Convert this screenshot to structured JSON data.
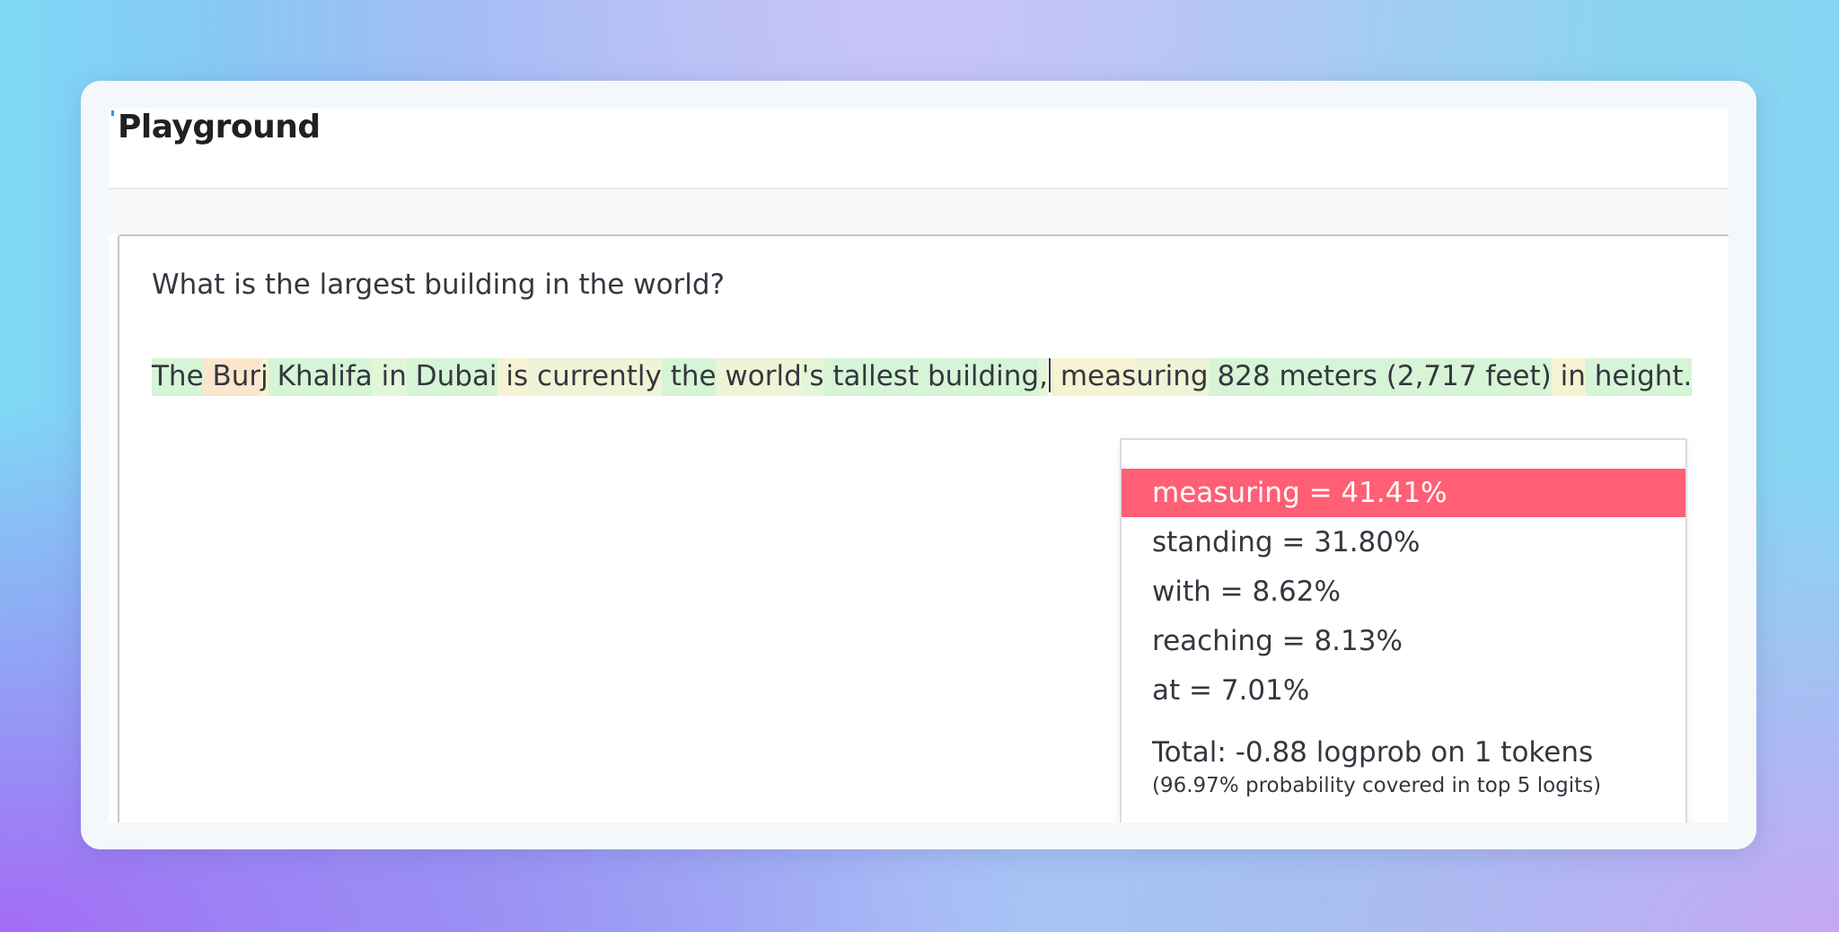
{
  "header": {
    "title": "Playground"
  },
  "editor": {
    "prompt": "What is the largest building in the world?",
    "completion_tokens": [
      {
        "text": "The",
        "tone": "t-green"
      },
      {
        "text": " Bur",
        "tone": "t-orange"
      },
      {
        "text": "j",
        "tone": "t-yellow"
      },
      {
        "text": " Khalifa",
        "tone": "t-green"
      },
      {
        "text": " in",
        "tone": "t-lgreen"
      },
      {
        "text": " Dubai",
        "tone": "t-green"
      },
      {
        "text": " is",
        "tone": "t-yellow"
      },
      {
        "text": " currently",
        "tone": "t-lyellow"
      },
      {
        "text": " the",
        "tone": "t-green"
      },
      {
        "text": " world",
        "tone": "t-lyellow"
      },
      {
        "text": "'s",
        "tone": "t-lgreen"
      },
      {
        "text": " tallest",
        "tone": "t-green"
      },
      {
        "text": " building",
        "tone": "t-green"
      },
      {
        "text": ",",
        "tone": "t-lgreen"
      },
      {
        "text": " meas",
        "tone": "t-yellow"
      },
      {
        "text": "uring",
        "tone": "t-lyellow"
      },
      {
        "text": " 828",
        "tone": "t-green"
      },
      {
        "text": " meters",
        "tone": "t-green"
      },
      {
        "text": " (2",
        "tone": "t-green"
      },
      {
        "text": ",717",
        "tone": "t-green"
      },
      {
        "text": " feet)",
        "tone": "t-green"
      },
      {
        "text": " in",
        "tone": "t-yellow"
      },
      {
        "text": " height.",
        "tone": "t-green"
      }
    ],
    "caret_after_token": 14
  },
  "popover": {
    "options": [
      {
        "label": "measuring = 41.41%",
        "selected": true
      },
      {
        "label": "standing = 31.80%",
        "selected": false
      },
      {
        "label": "with = 8.62%",
        "selected": false
      },
      {
        "label": "reaching = 8.13%",
        "selected": false
      },
      {
        "label": "at = 7.01%",
        "selected": false
      }
    ],
    "total": "Total: -0.88 logprob on 1 tokens",
    "coverage": "(96.97% probability covered in top 5 logits)"
  },
  "colors": {
    "selected_option": "#ff5f75",
    "text": "#353740"
  }
}
